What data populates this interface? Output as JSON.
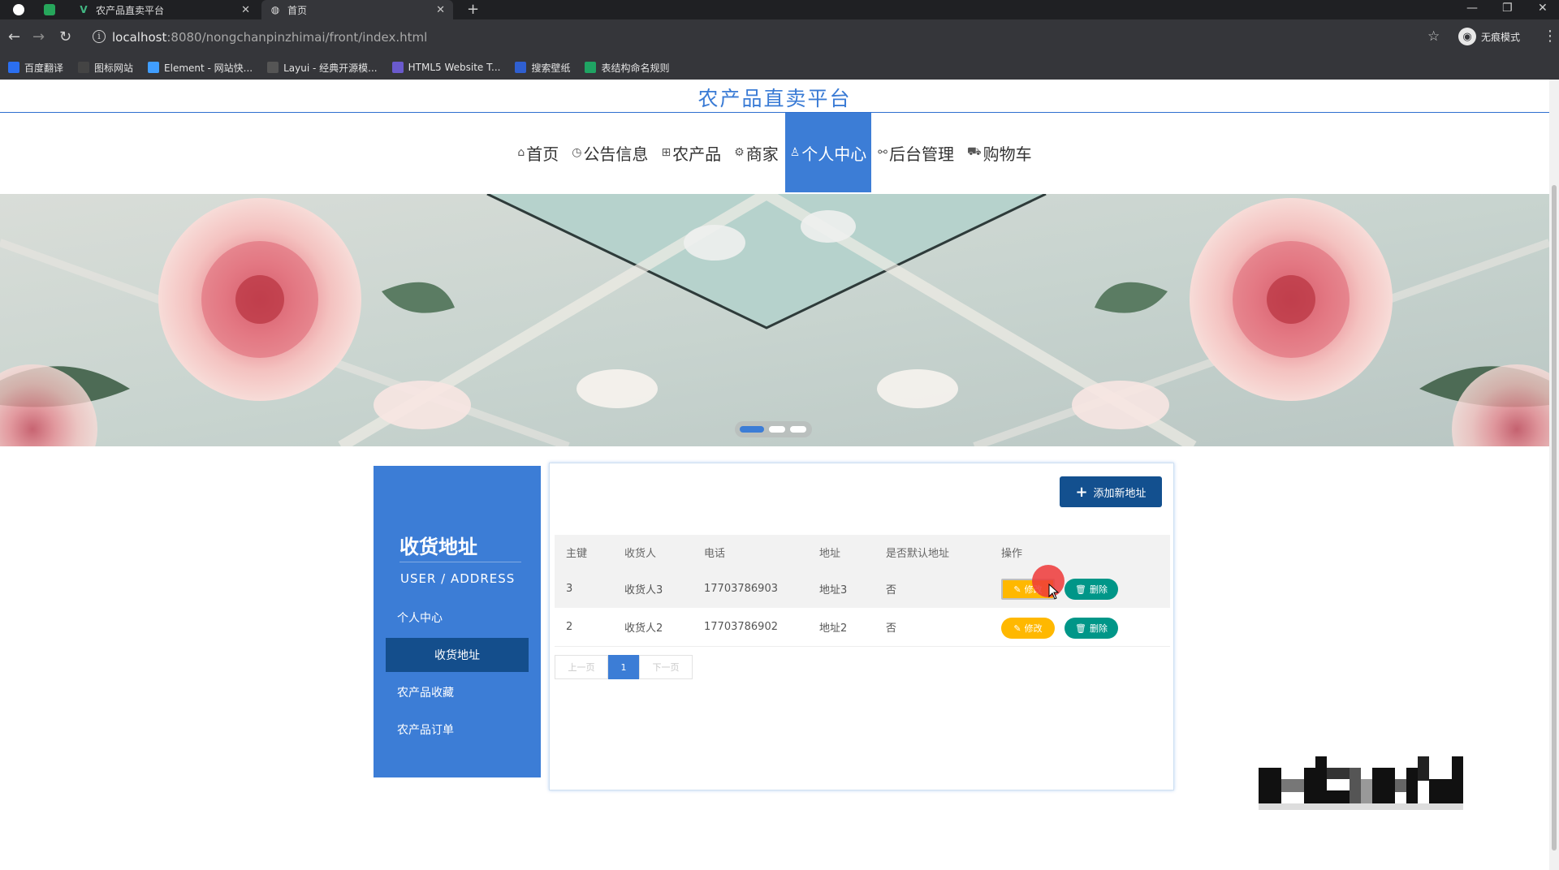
{
  "browser": {
    "tabs": [
      {
        "label": "",
        "active": false
      },
      {
        "label": "农产品直卖平台",
        "active": false
      },
      {
        "label": "首页",
        "active": true
      }
    ],
    "url_host": "localhost",
    "url_path": ":8080/nongchanpinzhimai/front/index.html",
    "profile_label": "无痕模式",
    "bookmarks": [
      {
        "label": "百度翻译",
        "color": "#2b6ff0"
      },
      {
        "label": "图标网站",
        "color": "#444444"
      },
      {
        "label": "Element - 网站快...",
        "color": "#409eff"
      },
      {
        "label": "Layui - 经典开源模...",
        "color": "#555555"
      },
      {
        "label": "HTML5 Website T...",
        "color": "#6a5acd"
      },
      {
        "label": "搜索壁纸",
        "color": "#2f5fd0"
      },
      {
        "label": "表结构命名规则",
        "color": "#1fa463"
      }
    ]
  },
  "site": {
    "title": "农产品直卖平台",
    "nav": [
      {
        "label": "首页",
        "icon": "home-icon",
        "glyph": "⌂",
        "active": false
      },
      {
        "label": "公告信息",
        "icon": "clock-icon",
        "glyph": "◷",
        "active": false
      },
      {
        "label": "农产品",
        "icon": "grid-icon",
        "glyph": "⊞",
        "active": false
      },
      {
        "label": "商家",
        "icon": "gear-icon",
        "glyph": "⚙",
        "active": false
      },
      {
        "label": "个人中心",
        "icon": "user-icon",
        "glyph": "♙",
        "active": true
      },
      {
        "label": "后台管理",
        "icon": "link-icon",
        "glyph": "⚯",
        "active": false
      },
      {
        "label": "购物车",
        "icon": "cart-icon",
        "glyph": "⛟",
        "active": false
      }
    ],
    "carousel_active_index": 0,
    "carousel_count": 3
  },
  "sidebar": {
    "title": "收货地址",
    "subtitle": "USER / ADDRESS",
    "items": [
      {
        "label": "个人中心",
        "active": false
      },
      {
        "label": "收货地址",
        "active": true
      },
      {
        "label": "农产品收藏",
        "active": false
      },
      {
        "label": "农产品订单",
        "active": false
      }
    ]
  },
  "main": {
    "add_button": "添加新地址",
    "columns": [
      "主键",
      "收货人",
      "电话",
      "地址",
      "是否默认地址",
      "操作"
    ],
    "rows": [
      {
        "id": "3",
        "name": "收货人3",
        "phone": "17703786903",
        "address": "地址3",
        "default": "否"
      },
      {
        "id": "2",
        "name": "收货人2",
        "phone": "17703786902",
        "address": "地址2",
        "default": "否"
      }
    ],
    "edit_label": "修改",
    "delete_label": "删除",
    "pager": {
      "prev": "上一页",
      "current": "1",
      "next": "下一页"
    }
  },
  "colors": {
    "primary": "#3c7dd6",
    "dark_primary": "#13508f",
    "edit": "#ffb800",
    "delete": "#009688"
  }
}
